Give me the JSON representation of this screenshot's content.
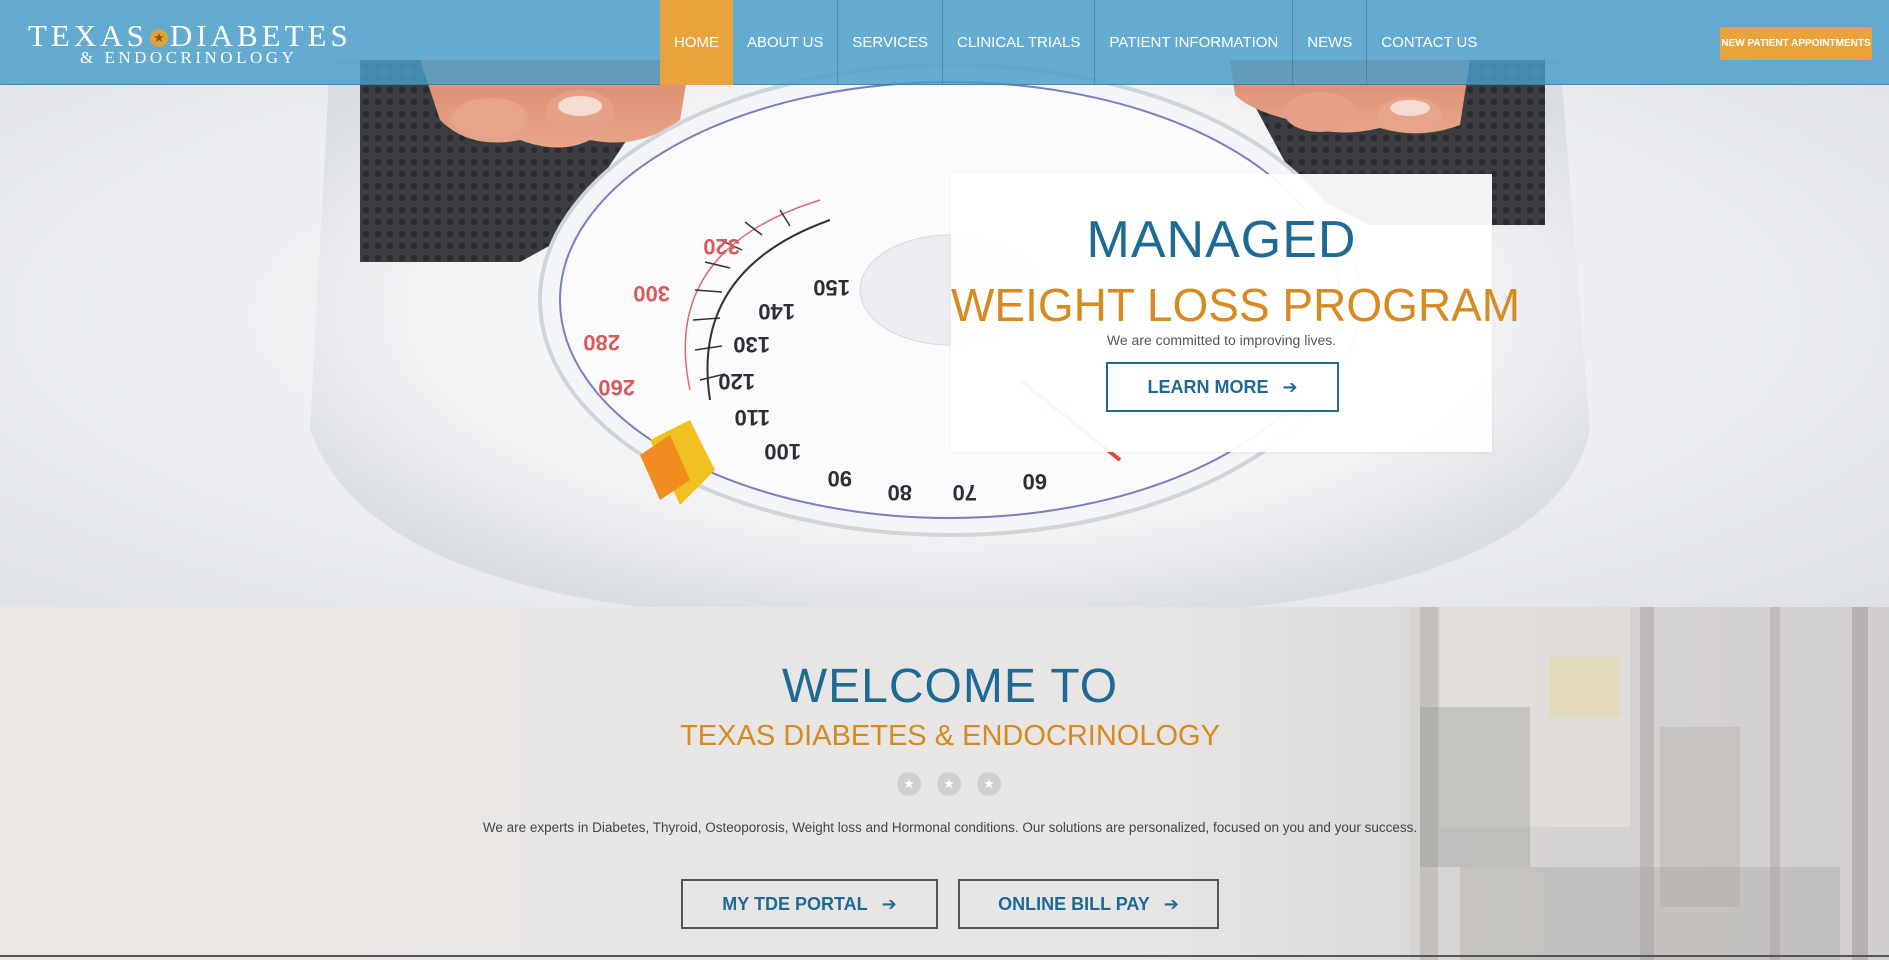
{
  "header": {
    "logo": {
      "word1": "TEXAS",
      "star": "★",
      "word2": "DIABETES",
      "sub": "& ENDOCRINOLOGY"
    },
    "nav": [
      {
        "label": "HOME",
        "active": true
      },
      {
        "label": "ABOUT US"
      },
      {
        "label": "SERVICES"
      },
      {
        "label": "CLINICAL TRIALS"
      },
      {
        "label": "PATIENT INFORMATION"
      },
      {
        "label": "NEWS"
      },
      {
        "label": "CONTACT US"
      }
    ],
    "appointment_button": "NEW PATIENT APPOINTMENTS"
  },
  "hero": {
    "title_line1": "MANAGED",
    "title_line2": "WEIGHT LOSS PROGRAM",
    "tagline": "We are committed to improving lives.",
    "button": "LEARN MORE",
    "arrow": "➔",
    "scale_numbers": [
      "320",
      "300",
      "280",
      "260",
      "150",
      "140",
      "130",
      "120",
      "110",
      "100",
      "90",
      "80",
      "70",
      "60"
    ]
  },
  "welcome": {
    "title": "WELCOME TO",
    "subtitle": "TEXAS DIABETES & ENDOCRINOLOGY",
    "stars": [
      "★",
      "★",
      "★"
    ],
    "text": "We are experts in Diabetes, Thyroid, Osteoporosis, Weight loss and Hormonal conditions.  Our solutions are personalized, focused on you and your success.",
    "portal_button": "MY TDE PORTAL",
    "bill_button": "ONLINE BILL PAY",
    "arrow": "➔"
  },
  "colors": {
    "header_bg": "#489eca",
    "accent_orange": "#e8a33d",
    "heading_blue": "#1e6a94",
    "heading_orange": "#d68a1f"
  }
}
